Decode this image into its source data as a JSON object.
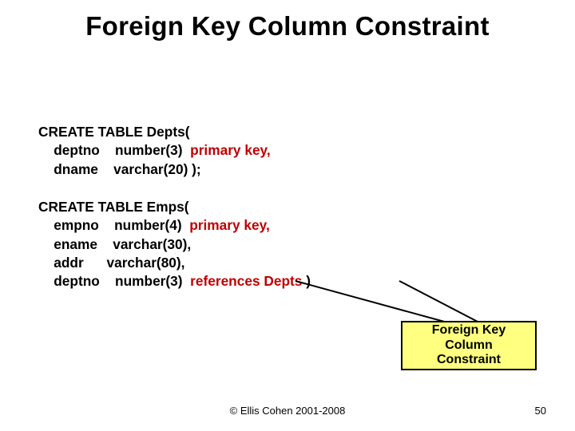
{
  "title": "Foreign Key Column Constraint",
  "code": {
    "depts": {
      "l1": "CREATE TABLE Depts(",
      "c1a": "deptno",
      "c1b": "number(3)",
      "c1c": "primary key,",
      "c2a": "dname",
      "c2b": "varchar(20) );"
    },
    "emps": {
      "l1": "CREATE TABLE Emps(",
      "c1a": "empno",
      "c1b": "number(4)",
      "c1c": "primary key,",
      "c2a": "ename",
      "c2b": "varchar(30),",
      "c3a": "addr",
      "c3b": "varchar(80),",
      "c4a": "deptno",
      "c4b": "number(3)",
      "c4c": "references Depts",
      "c4d": " )"
    }
  },
  "callout": "Foreign Key\nColumn\nConstraint",
  "footer": "© Ellis Cohen 2001-2008",
  "slide_no": "50"
}
